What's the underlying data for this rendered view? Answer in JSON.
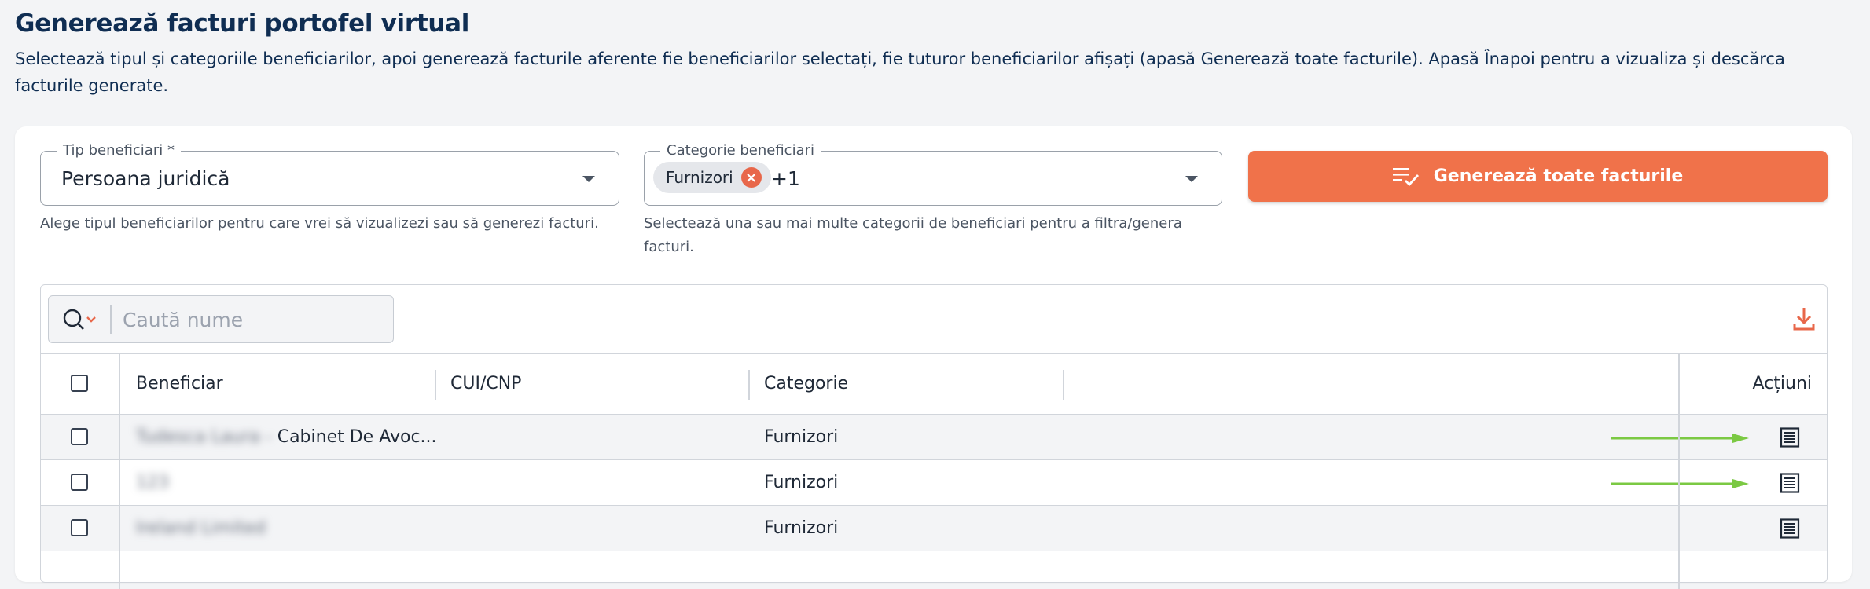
{
  "page": {
    "title": "Generează facturi portofel virtual",
    "description": "Selectează tipul și categoriile beneficiarilor, apoi generează facturile aferente fie beneficiarilor selectați, fie tuturor beneficiarilor afișați (apasă Generează toate facturile). Apasă Înapoi pentru a vizualiza și descărca facturile generate."
  },
  "filters": {
    "type": {
      "label": "Tip beneficiari *",
      "value": "Persoana juridică",
      "helper": "Alege tipul beneficiarilor pentru care vrei să vizualizezi sau să generezi facturi."
    },
    "category": {
      "label": "Categorie beneficiari",
      "chip": "Furnizori",
      "more": "+1",
      "helper": "Selectează una sau mai multe categorii de beneficiari pentru a filtra/genera facturi."
    },
    "generate_all_label": "Generează toate facturile"
  },
  "search": {
    "placeholder": "Caută nume"
  },
  "table": {
    "columns": [
      "Beneficiar",
      "CUI/CNP",
      "Categorie",
      "Acțiuni"
    ],
    "rows": [
      {
        "name_blurred": "Tudesca Laura - ",
        "name_visible": "Cabinet De Avoc...",
        "cui": "",
        "category": "Furnizori"
      },
      {
        "name_blurred": "123",
        "name_visible": "",
        "cui": "",
        "category": "Furnizori"
      },
      {
        "name_blurred": "Ireland Limited",
        "name_visible": "",
        "cui": "",
        "category": "Furnizori"
      }
    ]
  },
  "colors": {
    "accent": "#f0724a",
    "title": "#0f2d52",
    "annotation_arrow": "#7bc943"
  },
  "icons": [
    "chevron-down-icon",
    "close-icon",
    "checklist-icon",
    "search-icon",
    "download-icon",
    "invoice-icon"
  ]
}
